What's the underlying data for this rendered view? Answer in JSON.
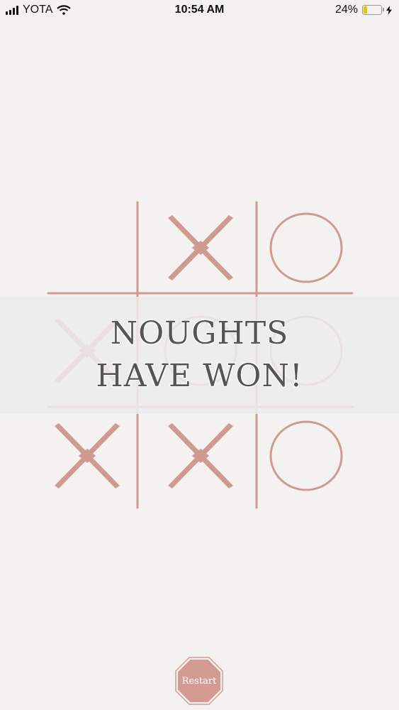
{
  "status_bar": {
    "carrier": "YOTA",
    "time": "10:54 AM",
    "battery_percent": "24%",
    "battery_level": 0.24,
    "icons": [
      "signal-bars-icon",
      "wifi-icon",
      "battery-icon",
      "charging-bolt-icon"
    ]
  },
  "board": {
    "cells": [
      "",
      "X",
      "O",
      "X",
      "O",
      "O",
      "X",
      "X",
      "O"
    ],
    "accent_color": "#cf9a90"
  },
  "result": {
    "line1": "NOUGHTS",
    "line2": "HAVE WON!"
  },
  "restart": {
    "label": "Restart",
    "color": "#d49b93"
  }
}
